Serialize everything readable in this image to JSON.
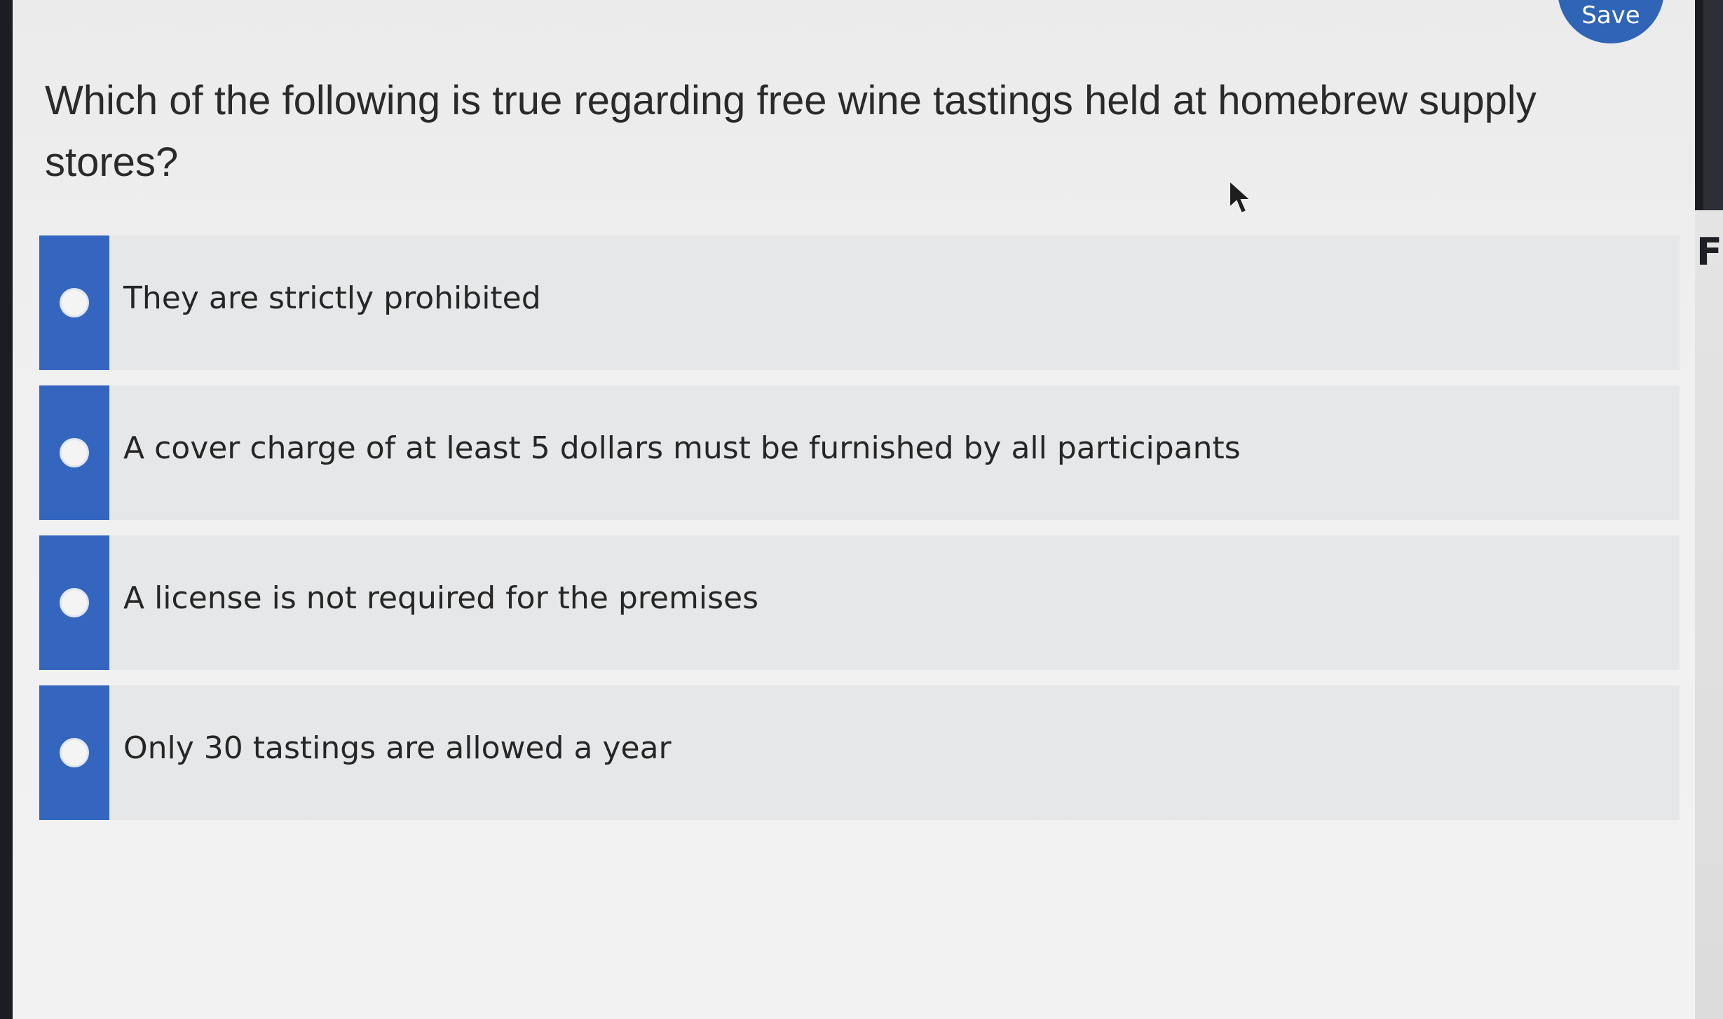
{
  "header": {
    "save_label": "Save"
  },
  "question": {
    "text": "Which of the following is true regarding free wine tastings held at homebrew supply stores?"
  },
  "options": [
    {
      "label": "They are strictly prohibited",
      "selected": false
    },
    {
      "label": "A cover charge of at least 5 dollars must be furnished by all participants",
      "selected": false
    },
    {
      "label": "A license is not required for the premises",
      "selected": false
    },
    {
      "label": "Only 30 tastings are allowed a year",
      "selected": false
    }
  ],
  "edge_text": "F",
  "colors": {
    "accent": "#3466bf",
    "save_button": "#2f64b6",
    "option_background": "#e6e7e8",
    "page_background": "#f0f0f0"
  },
  "icons": {
    "radio": "radio-unselected-icon",
    "cursor": "mouse-pointer-icon"
  }
}
